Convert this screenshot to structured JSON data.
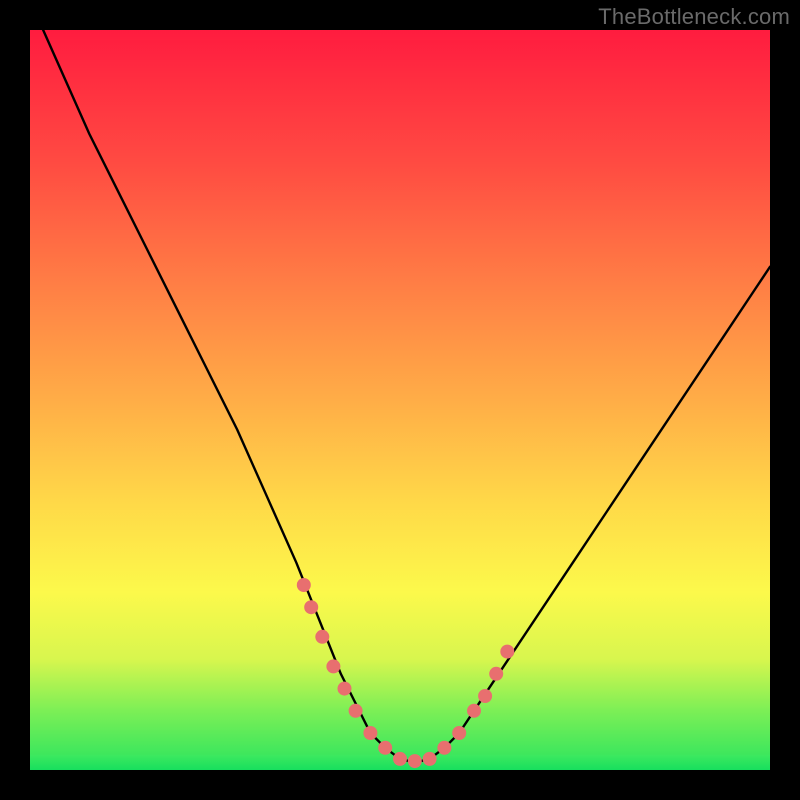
{
  "watermark": "TheBottleneck.com",
  "chart_data": {
    "type": "line",
    "title": "",
    "xlabel": "",
    "ylabel": "",
    "xlim": [
      0,
      100
    ],
    "ylim": [
      0,
      100
    ],
    "series": [
      {
        "name": "curve",
        "x": [
          0,
          4,
          8,
          12,
          16,
          20,
          24,
          28,
          32,
          36,
          38,
          40,
          42,
          44,
          46,
          48,
          50,
          52,
          54,
          56,
          58,
          60,
          62,
          66,
          70,
          74,
          78,
          82,
          86,
          90,
          94,
          98,
          100
        ],
        "y": [
          104,
          95,
          86,
          78,
          70,
          62,
          54,
          46,
          37,
          28,
          23,
          18,
          13,
          9,
          5,
          3,
          1.5,
          1,
          1.5,
          3,
          5,
          8,
          11,
          17,
          23,
          29,
          35,
          41,
          47,
          53,
          59,
          65,
          68
        ]
      }
    ],
    "markers": {
      "name": "highlight-dots",
      "x": [
        37,
        38,
        39.5,
        41,
        42.5,
        44,
        46,
        48,
        50,
        52,
        54,
        56,
        58,
        60,
        61.5,
        63,
        64.5
      ],
      "y": [
        25,
        22,
        18,
        14,
        11,
        8,
        5,
        3,
        1.5,
        1.2,
        1.5,
        3,
        5,
        8,
        10,
        13,
        16
      ]
    },
    "curve_color": "#000000",
    "marker_color": "#e86f6f",
    "gradient_stops": [
      {
        "pos": 0,
        "color": "#ff1c3f"
      },
      {
        "pos": 18,
        "color": "#ff4b42"
      },
      {
        "pos": 34,
        "color": "#ff7d45"
      },
      {
        "pos": 50,
        "color": "#ffad47"
      },
      {
        "pos": 64,
        "color": "#ffd948"
      },
      {
        "pos": 76,
        "color": "#fcf94b"
      },
      {
        "pos": 85,
        "color": "#d8f64e"
      },
      {
        "pos": 92,
        "color": "#7cef56"
      },
      {
        "pos": 100,
        "color": "#28e45f"
      }
    ]
  }
}
